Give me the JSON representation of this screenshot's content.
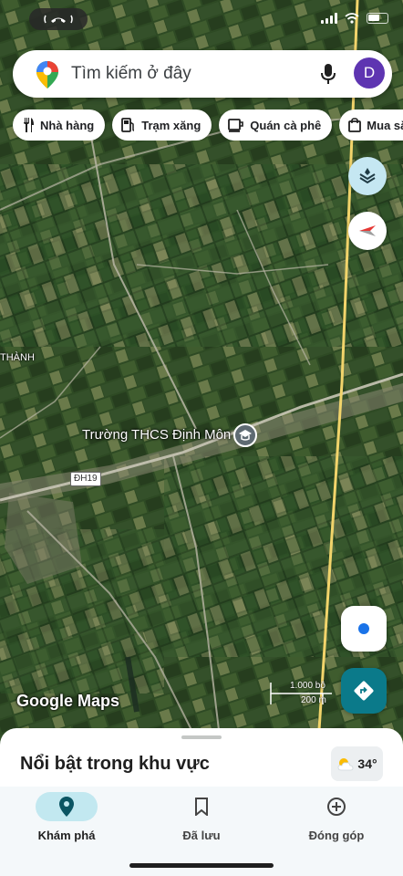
{
  "search": {
    "placeholder": "Tìm kiếm ở đây",
    "avatar_letter": "D"
  },
  "chips": [
    {
      "label": "Nhà hàng",
      "icon": "restaurant-icon"
    },
    {
      "label": "Trạm xăng",
      "icon": "gas-station-icon"
    },
    {
      "label": "Quán cà phê",
      "icon": "coffee-icon"
    },
    {
      "label": "Mua sắm",
      "icon": "shopping-bag-icon"
    }
  ],
  "map": {
    "place_label": "Trường THCS Định Môn",
    "area_label": "THÀNH",
    "road_shield": "ĐH19",
    "attribution": "Google Maps",
    "scale_top": "1.000 bộ",
    "scale_bottom": "200 m"
  },
  "sheet": {
    "title": "Nổi bật trong khu vực",
    "weather_temp": "34°"
  },
  "nav": {
    "explore": "Khám phá",
    "saved": "Đã lưu",
    "contribute": "Đóng góp",
    "active": "explore"
  },
  "colors": {
    "accent": "#0b7a8a",
    "layers_bg": "#c5e7f2",
    "nav_active_bg": "#c2e8f0",
    "road_yellow": "#f2d46b"
  }
}
